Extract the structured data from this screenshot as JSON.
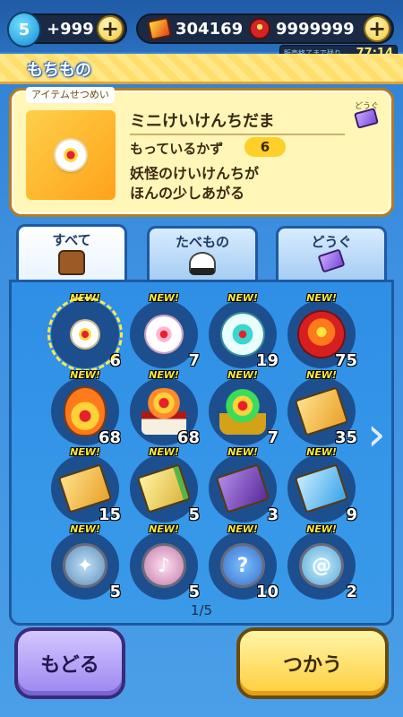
{
  "status": {
    "level": "5",
    "level_value": "+999",
    "coins": "304169",
    "orbs": "9999999",
    "timer_label": "販売終了まで残り",
    "timer_value": "77:14"
  },
  "header": {
    "title": "もちもの"
  },
  "description": {
    "tab_label": "アイテムせつめい",
    "item_name": "ミニけいけんちだま",
    "category": "どうぐ",
    "count_label": "もっているかず",
    "count_value": "6",
    "text": "妖怪のけいけんちが\nほんの少しあがる"
  },
  "tabs": [
    {
      "label": "すべて",
      "icon": "bag-icon",
      "active": true
    },
    {
      "label": "たべもの",
      "icon": "onigiri-icon",
      "active": false
    },
    {
      "label": "どうぐ",
      "icon": "ticket-icon",
      "active": false
    }
  ],
  "items": [
    {
      "name": "mini-exp-orb",
      "new": "NEW!",
      "qty": "6"
    },
    {
      "name": "exp-orb-pink",
      "new": "NEW!",
      "qty": "7"
    },
    {
      "name": "exp-orb-teal",
      "new": "NEW!",
      "qty": "19"
    },
    {
      "name": "exp-orb-red",
      "new": "NEW!",
      "qty": "75"
    },
    {
      "name": "fire-exp-orb",
      "new": "NEW!",
      "qty": "68"
    },
    {
      "name": "shrine-exp-orb",
      "new": "NEW!",
      "qty": "68"
    },
    {
      "name": "green-exp-orb",
      "new": "NEW!",
      "qty": "7"
    },
    {
      "name": "skill-book-orange",
      "new": "NEW!",
      "qty": "35"
    },
    {
      "name": "skill-book-orange-2",
      "new": "NEW!",
      "qty": "15"
    },
    {
      "name": "skill-book-green",
      "new": "NEW!",
      "qty": "5"
    },
    {
      "name": "skill-book-purple",
      "new": "NEW!",
      "qty": "3"
    },
    {
      "name": "skill-book-blue",
      "new": "NEW!",
      "qty": "9"
    },
    {
      "name": "star-coin",
      "new": "NEW!",
      "qty": "5"
    },
    {
      "name": "music-coin",
      "new": "NEW!",
      "qty": "5"
    },
    {
      "name": "question-coin",
      "new": "NEW!",
      "qty": "10"
    },
    {
      "name": "swirl-coin",
      "new": "NEW!",
      "qty": "2"
    }
  ],
  "pagination": {
    "text": "1/5"
  },
  "buttons": {
    "back": "もどる",
    "use": "つかう"
  },
  "colors": {
    "accent_yellow": "#ffcd3a",
    "panel_blue": "#2f8fe6",
    "back_purple": "#9b86f0"
  }
}
